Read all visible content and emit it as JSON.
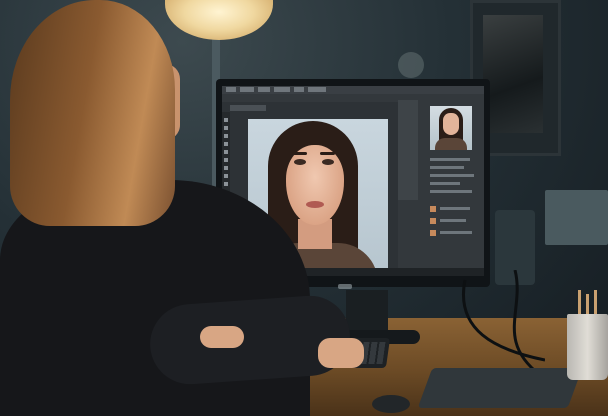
{
  "scene": {
    "kind": "photo",
    "colors": {
      "background": "#1a2228",
      "ps_ui": "#2d3236",
      "ps_accent": "#2f7cd0",
      "desk": "#7a5630",
      "lamp": "#f0d8a0"
    },
    "icons": [
      "lamp-icon",
      "monitor-icon",
      "keyboard-icon",
      "mouse-icon"
    ]
  }
}
